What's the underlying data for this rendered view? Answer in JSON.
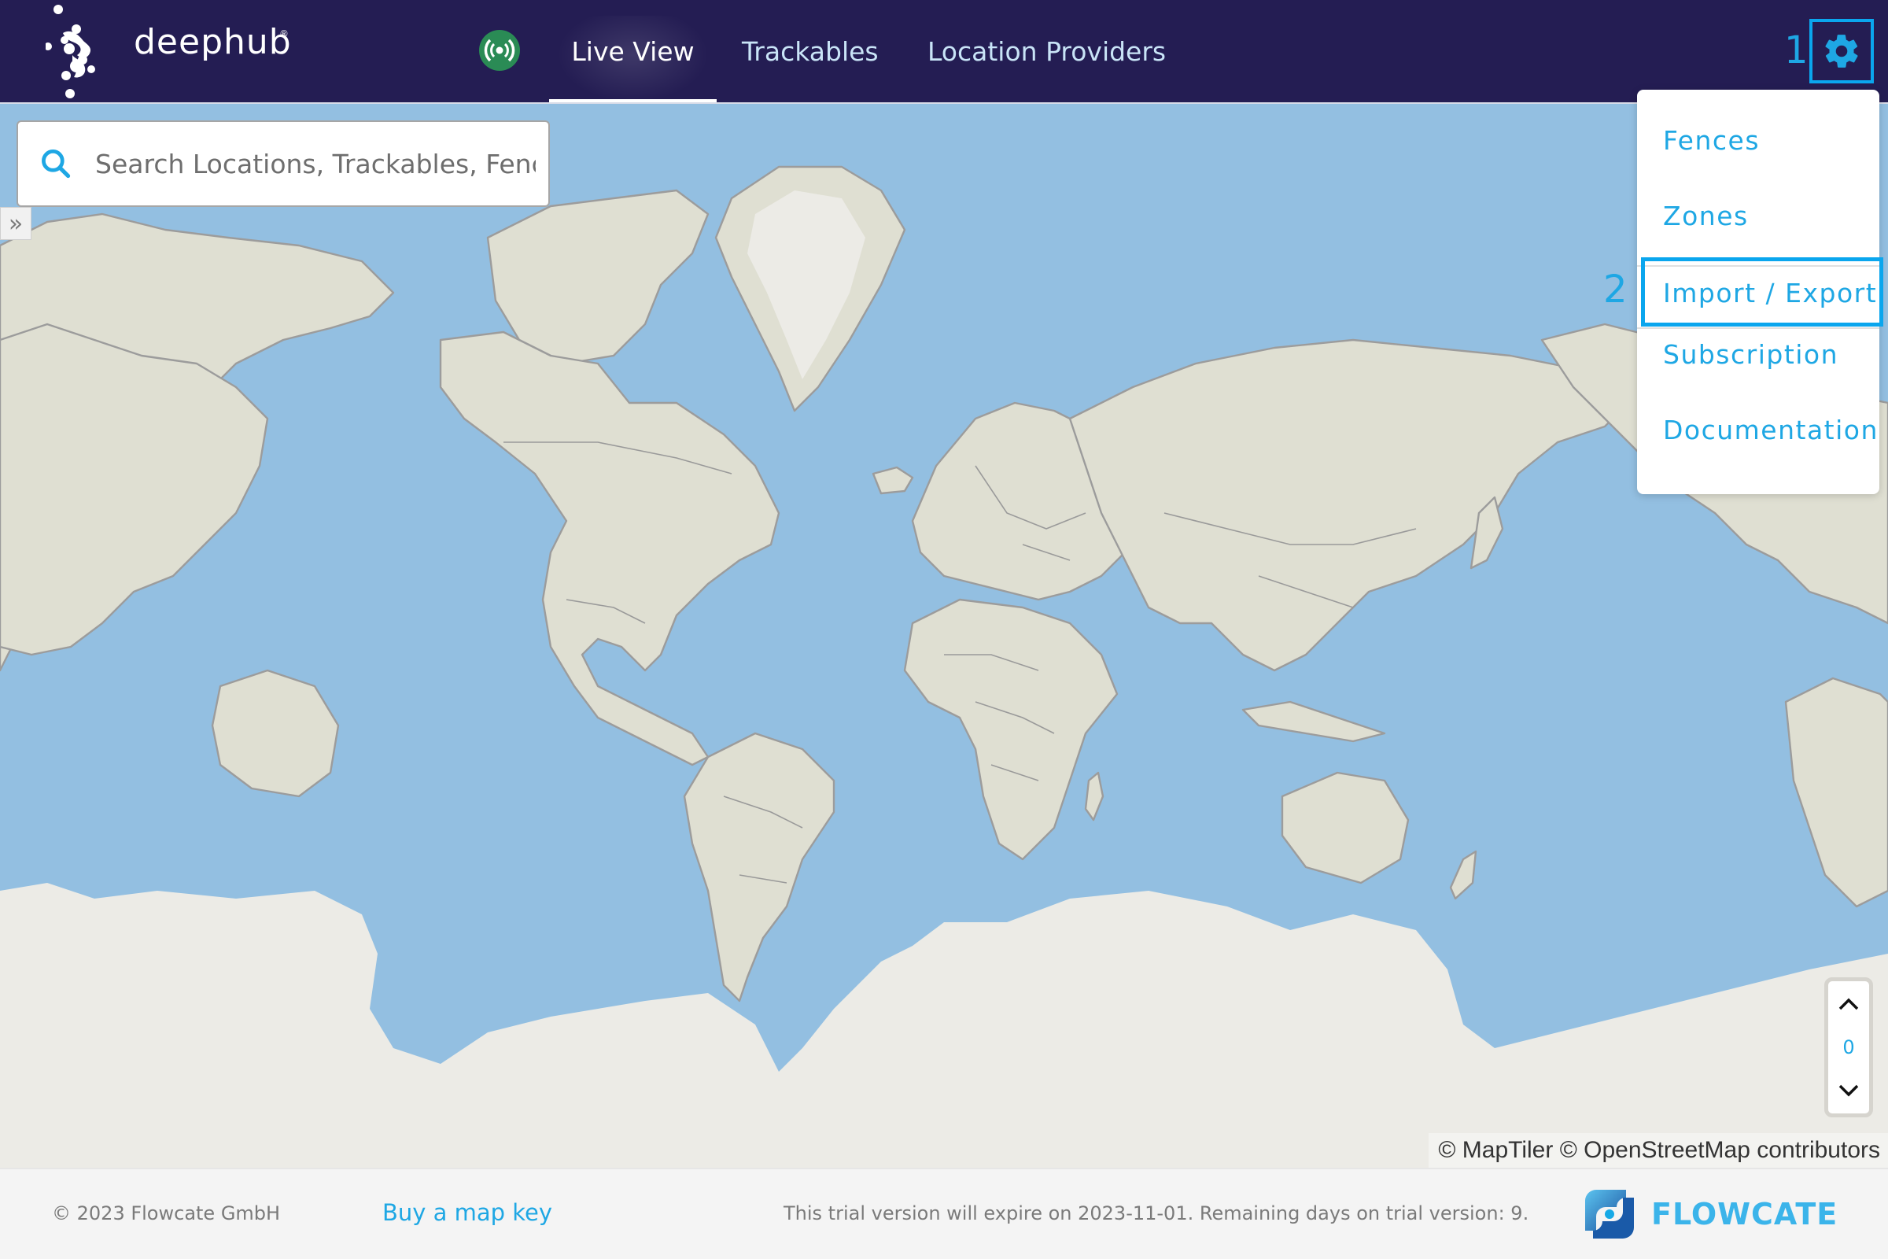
{
  "header": {
    "logo_text": "deephub",
    "logo_mark": "®",
    "connection_status_icon": "broadcast-icon",
    "connection_status_color": "#2a8b55",
    "nav": [
      {
        "label": "Live View",
        "active": true
      },
      {
        "label": "Trackables",
        "active": false
      },
      {
        "label": "Location Providers",
        "active": false
      }
    ],
    "settings_icon": "gear-icon",
    "accent_color": "#1ea7e4",
    "background_color": "#241d53"
  },
  "annotations": {
    "step1": "1",
    "step2": "2",
    "highlight_color": "#0aa6ee"
  },
  "search": {
    "placeholder": "Search Locations, Trackables, Fences",
    "value": ""
  },
  "sidebar_toggle": {
    "icon": "double-chevron-right-icon",
    "label": "»"
  },
  "settings_menu": {
    "items": [
      {
        "label": "Fences"
      },
      {
        "label": "Zones"
      },
      {
        "label": "Import / Export",
        "highlighted": true
      },
      {
        "label": "Subscription"
      },
      {
        "label": "Documentation"
      }
    ]
  },
  "level_control": {
    "value": "0",
    "up_icon": "chevron-up-icon",
    "down_icon": "chevron-down-icon"
  },
  "map": {
    "attribution": "© MapTiler © OpenStreetMap contributors",
    "water_color": "#93bfe1",
    "land_color": "#dfdfd2",
    "ice_color": "#ecebe6"
  },
  "footer": {
    "copyright": "© 2023 Flowcate GmbH",
    "buy_link": "Buy a map key",
    "trial_notice": "This trial version will expire on 2023-11-01. Remaining days on trial version: 9.",
    "brand": "FLOWCATE"
  }
}
